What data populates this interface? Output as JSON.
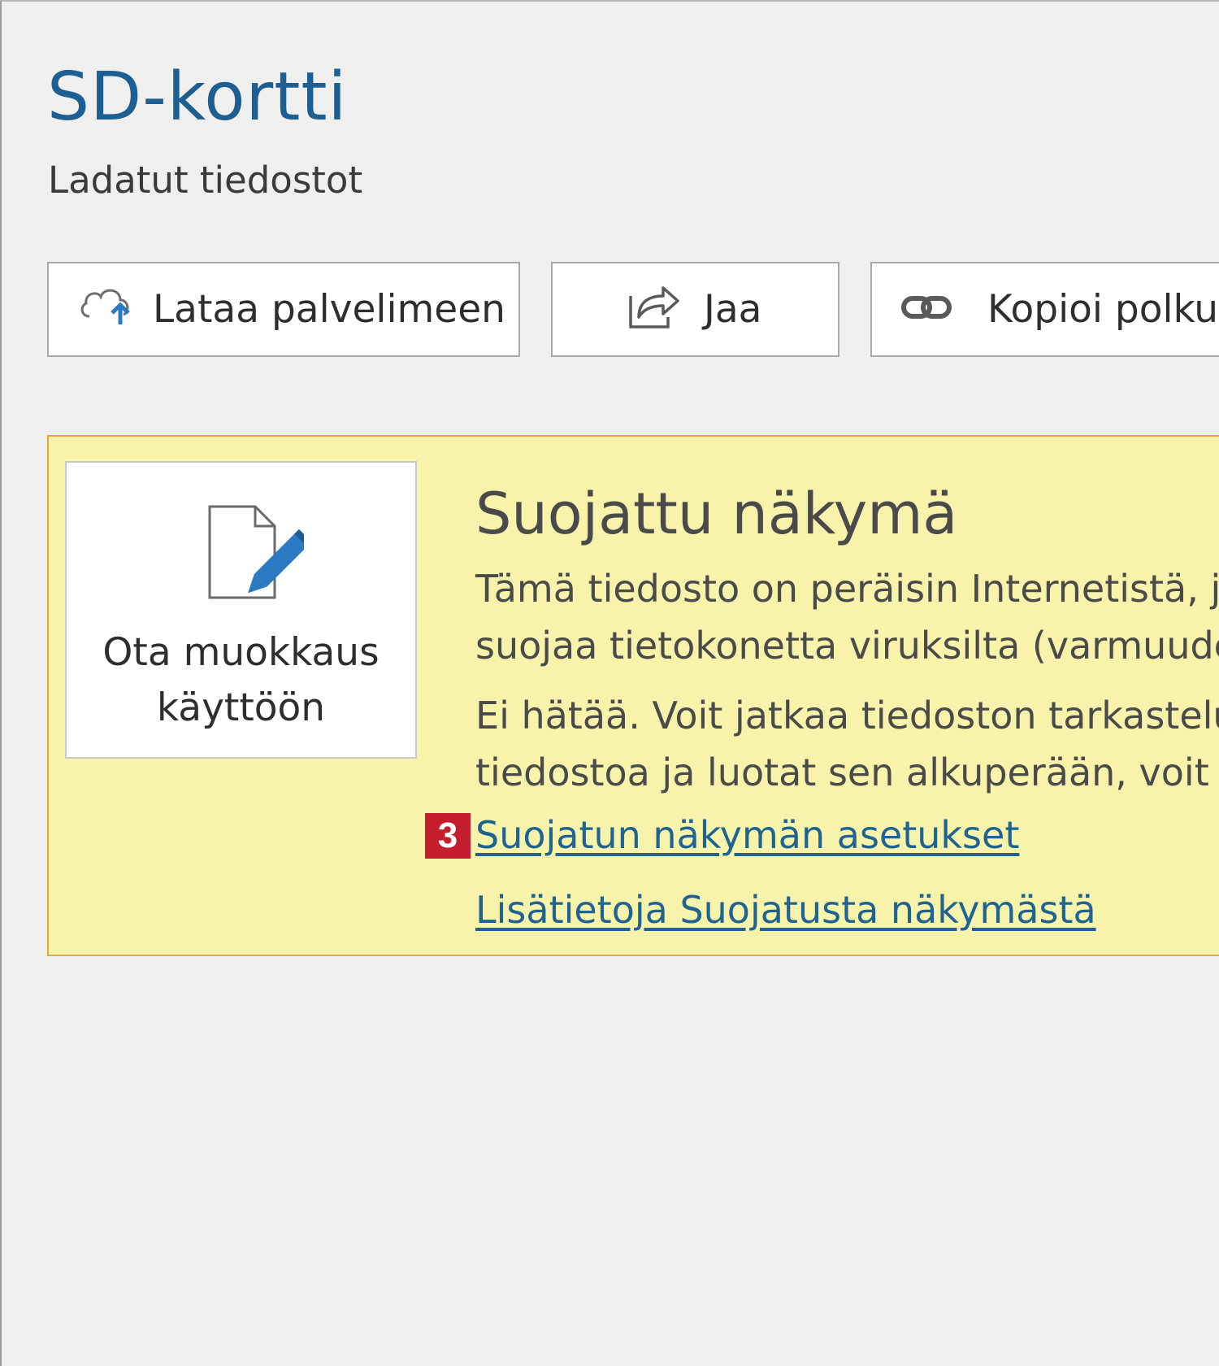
{
  "header": {
    "title": "SD-kortti",
    "subtitle": "Ladatut tiedostot"
  },
  "toolbar": {
    "upload_label": "Lataa palvelimeen",
    "upload_icon": "cloud-upload-icon",
    "share_label": "Jaa",
    "share_icon": "share-icon",
    "copy_path_label": "Kopioi polku",
    "copy_path_icon": "link-icon"
  },
  "protected_view": {
    "enable_edit_line1": "Ota muokkaus",
    "enable_edit_line2": "käyttöön",
    "enable_edit_icon": "edit-document-icon",
    "title": "Suojattu näkymä",
    "paragraph1_line1": "Tämä tiedosto on peräisin Internetistä, jo",
    "paragraph1_line2": "suojaa tietokonetta viruksilta (varmuude",
    "paragraph2_line1": "Ei hätää. Voit jatkaa tiedoston tarkastelu",
    "paragraph2_line2": "tiedostoa ja luotat sen alkuperään, voit o",
    "settings_link": "Suojatun näkymän asetukset",
    "learn_more_link": "Lisätietoja Suojatusta näkymästä",
    "step_badge": "3"
  },
  "colors": {
    "title_blue": "#1d5f93",
    "link_blue": "#1f6391",
    "banner_bg": "#f8f3ab",
    "banner_border": "#e3a73a",
    "badge_red": "#c31d2e",
    "upload_arrow_blue": "#2b79c2"
  }
}
